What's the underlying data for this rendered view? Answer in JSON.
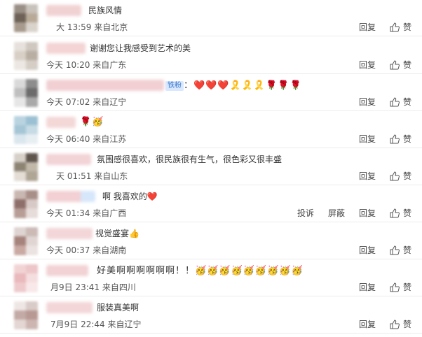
{
  "actions": {
    "reply": "回复",
    "like": "赞",
    "report": "投诉",
    "block": "屏蔽"
  },
  "comments": [
    {
      "content": "民族风情",
      "time": "大 13:59",
      "location": "来自北京"
    },
    {
      "content": "谢谢您让我感受到艺术的美",
      "time": "今天 10:20",
      "location": "来自广东"
    },
    {
      "badge": "铁粉",
      "content": "：❤️❤️❤️🎗️🎗️🎗️🌹🌹🌹",
      "time": "今天 07:02",
      "location": "来自辽宁"
    },
    {
      "content": "🌹🥳",
      "time": "今天 06:40",
      "location": "来自江苏"
    },
    {
      "content": "氛围感很喜欢，很民族很有生气，很色彩又很丰盛",
      "time": "天 01:51",
      "location": "来自山东"
    },
    {
      "content": "啊 我喜欢的❤️",
      "time": "今天 01:34",
      "location": "来自广西"
    },
    {
      "content": "视觉盛宴👍",
      "time": "今天 00:37",
      "location": "来自湖南"
    },
    {
      "content": "好美啊啊啊啊啊啊！！🥳🥳🥳🥳🥳🥳🥳🥳🥳",
      "time": "月9日 23:41",
      "location": "来自四川"
    },
    {
      "content": "服装真美啊",
      "time": "7月9日 22:44",
      "location": "来自辽宁"
    }
  ]
}
